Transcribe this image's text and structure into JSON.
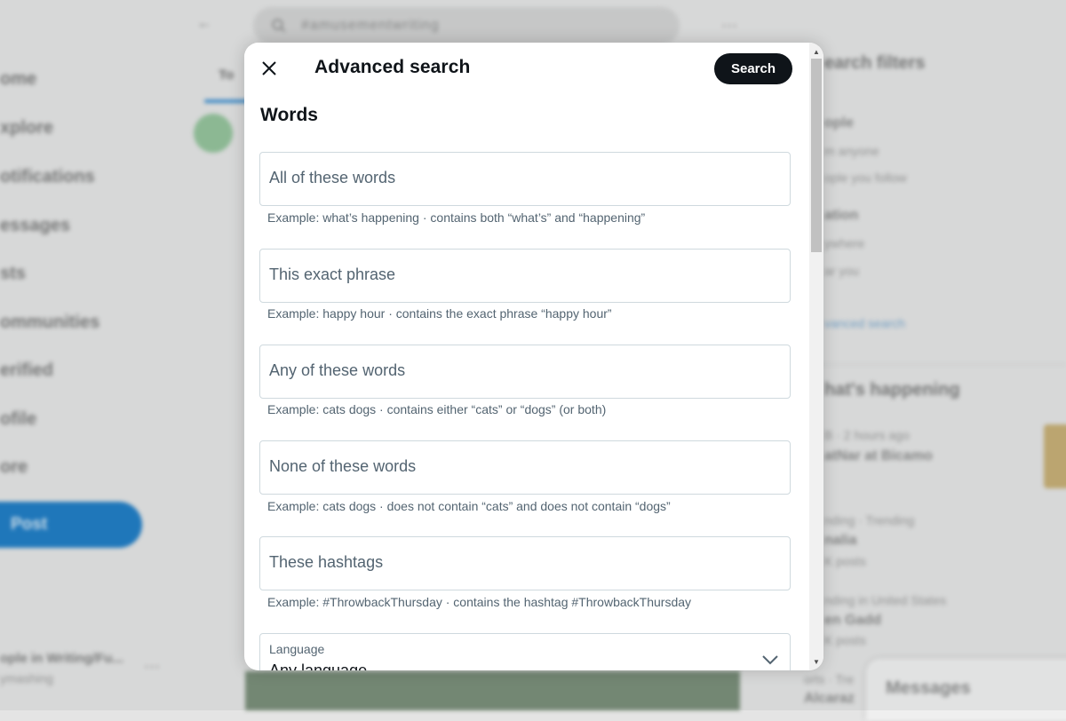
{
  "background": {
    "nav_items": [
      "ome",
      "xplore",
      "otifications",
      "essages",
      "sts",
      "ommunities",
      "erified",
      "ofile",
      "ore"
    ],
    "post_button": "Post",
    "account_name": "ople in Writing/Fu...",
    "account_handle": "ymashing",
    "account_more": "···",
    "search_query": "#amusementwriting",
    "top_tab": "To",
    "right": {
      "filters_title": "earch filters",
      "people_title": "ople",
      "people_opt1": "m anyone",
      "people_opt2": "ople you follow",
      "location_title": "ation",
      "location_opt1": "ywhere",
      "location_opt2": "ar you",
      "advanced_link": "vanced search",
      "happening_title": "hat's happening",
      "trend1_meta": "B · 2 hours ago",
      "trend1_title": "atNar at Bicamo",
      "trend2_meta": "nding · Trending",
      "trend2_title": "nalia",
      "trend2_posts": "K posts",
      "trend3_meta": "nding in United States",
      "trend3_title": "en Gadd",
      "trend3_posts": "K posts",
      "trend4_meta": "orts · Tre",
      "trend4_title": "Alcaraz"
    },
    "messages_label": "Messages"
  },
  "modal": {
    "title": "Advanced search",
    "search_button": "Search",
    "close_icon": "close-icon",
    "section_title": "Words",
    "fields": [
      {
        "placeholder": "All of these words",
        "hint": "Example: what’s happening · contains both “what’s” and “happening”"
      },
      {
        "placeholder": "This exact phrase",
        "hint": "Example: happy hour · contains the exact phrase “happy hour”"
      },
      {
        "placeholder": "Any of these words",
        "hint": "Example: cats dogs · contains either “cats” or “dogs” (or both)"
      },
      {
        "placeholder": "None of these words",
        "hint": "Example: cats dogs · does not contain “cats” and does not contain “dogs”"
      },
      {
        "placeholder": "These hashtags",
        "hint": "Example: #ThrowbackThursday · contains the hashtag #ThrowbackThursday"
      }
    ],
    "language": {
      "label": "Language",
      "value": "Any language"
    }
  },
  "colors": {
    "primary_text": "#0f1419",
    "secondary_text": "#536471",
    "border": "#cfd9de",
    "search_button_bg": "#0f1419"
  }
}
